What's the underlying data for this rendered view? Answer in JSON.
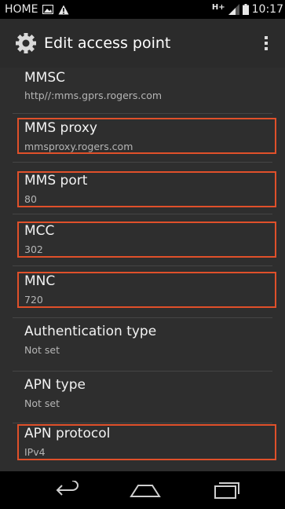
{
  "status_bar": {
    "carrier_label": "HOME",
    "network": "H+",
    "time": "10:17",
    "icons": [
      "gallery-icon",
      "warning-icon",
      "signal-icon",
      "battery-icon"
    ]
  },
  "action_bar": {
    "title": "Edit access point",
    "icons": [
      "settings-gear-icon",
      "overflow-menu-icon"
    ]
  },
  "settings": [
    {
      "label": "MMSC",
      "value": "http//:mms.gprs.rogers.com",
      "highlighted": false
    },
    {
      "label": "MMS proxy",
      "value": "mmsproxy.rogers.com",
      "highlighted": true
    },
    {
      "label": "MMS port",
      "value": "80",
      "highlighted": true
    },
    {
      "label": "MCC",
      "value": "302",
      "highlighted": true
    },
    {
      "label": "MNC",
      "value": "720",
      "highlighted": true
    },
    {
      "label": "Authentication type",
      "value": "Not set",
      "highlighted": false
    },
    {
      "label": "APN type",
      "value": "Not set",
      "highlighted": false
    },
    {
      "label": "APN protocol",
      "value": "IPv4",
      "highlighted": true
    }
  ],
  "nav_bar": {
    "icons": [
      "back-icon",
      "home-icon",
      "recent-apps-icon"
    ]
  },
  "colors": {
    "highlight": "#e0502a",
    "list_background": "#2e2e2e",
    "action_bar": "#2b2b2b"
  }
}
